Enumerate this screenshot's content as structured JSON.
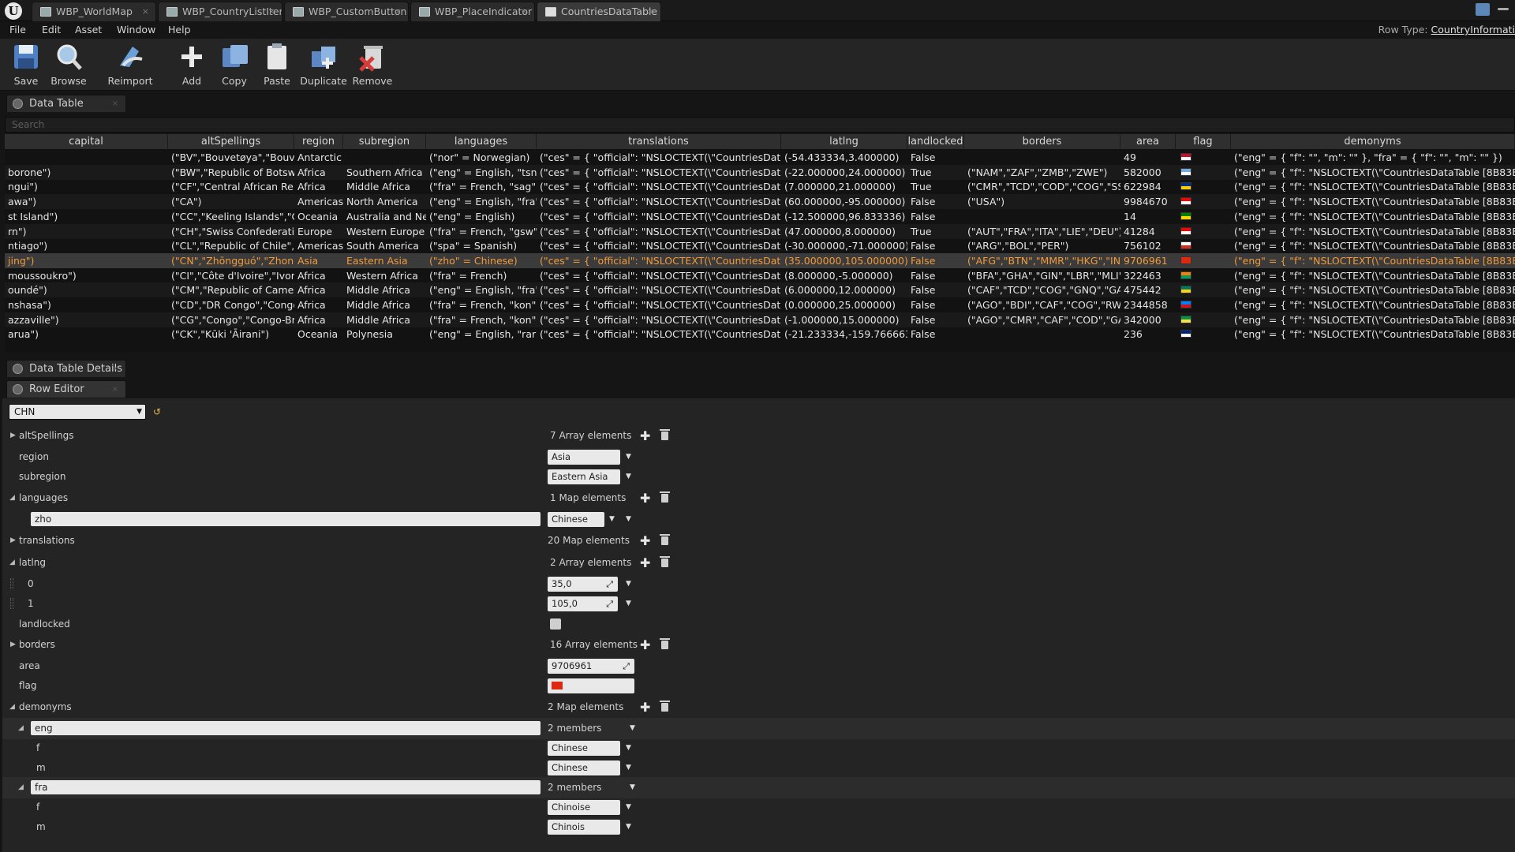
{
  "window": {
    "logo": "U",
    "tabs": [
      {
        "label": "WBP_WorldMap"
      },
      {
        "label": "WBP_CountryListItem"
      },
      {
        "label": "WBP_CustomButton"
      },
      {
        "label": "WBP_PlaceIndicator"
      },
      {
        "label": "CountriesDataTable"
      }
    ],
    "close_glyph": "×"
  },
  "menu": {
    "items": [
      "File",
      "Edit",
      "Asset",
      "Window",
      "Help"
    ],
    "row_type_label": "Row Type:",
    "row_type_value": "CountryInformati"
  },
  "toolbar": {
    "buttons": [
      {
        "label": "Save",
        "icon": "save-disk-icon"
      },
      {
        "label": "Browse",
        "icon": "magnifier-icon"
      },
      {
        "label": "Reimport",
        "icon": "reimport-arrow-icon"
      },
      {
        "label": "Add",
        "icon": "plus-icon"
      },
      {
        "label": "Copy",
        "icon": "copy-icon"
      },
      {
        "label": "Paste",
        "icon": "clipboard-icon"
      },
      {
        "label": "Duplicate",
        "icon": "duplicate-icon"
      },
      {
        "label": "Remove",
        "icon": "trash-remove-icon"
      }
    ]
  },
  "data_table": {
    "tab_label": "Data Table",
    "search_placeholder": "Search",
    "columns": [
      "capital",
      "altSpellings",
      "region",
      "subregion",
      "languages",
      "translations",
      "latlng",
      "landlocked",
      "borders",
      "area",
      "flag",
      "demonyms"
    ],
    "rows": [
      {
        "cells": [
          "",
          "(\"BV\",\"Bouvetøya\",\"Bouvet-",
          "Antarctic",
          "",
          "(\"nor\" = Norwegian)",
          "(\"ces\" = { \"official\": \"NSLOCTEXT(\\\"CountriesDataTable",
          "(-54.433334,3.400000)",
          "False",
          "",
          "49",
          "",
          "(\"eng\" = { \"f\": \"\", \"m\": \"\" }, \"fra\" = { \"f\": \"\", \"m\": \"\" })"
        ],
        "flag_colors": [
          "#c8102e",
          "#ffffff"
        ],
        "selected": false
      },
      {
        "cells": [
          "borone\")",
          "(\"BW\",\"Republic of Botswa",
          "Africa",
          "Southern Africa",
          "(\"eng\" = English, \"tsn\" =",
          "(\"ces\" = { \"official\": \"NSLOCTEXT(\\\"CountriesDataTable",
          "(-22.000000,24.000000)",
          "True",
          "(\"NAM\",\"ZAF\",\"ZMB\",\"ZWE\")",
          "582000",
          "",
          "(\"eng\" = { \"f\": \"NSLOCTEXT(\\\"CountriesDataTable [8B83B96C409"
        ],
        "flag_colors": [
          "#75aadb",
          "#ffffff"
        ],
        "selected": false
      },
      {
        "cells": [
          "ngui\")",
          "(\"CF\",\"Central African Repu",
          "Africa",
          "Middle Africa",
          "(\"fra\" = French, \"sag\" = S",
          "(\"ces\" = { \"official\": \"NSLOCTEXT(\\\"CountriesDataTable",
          "(7.000000,21.000000)",
          "True",
          "(\"CMR\",\"TCD\",\"COD\",\"COG\",\"SSD\",\"SI",
          "622984",
          "",
          "(\"eng\" = { \"f\": \"NSLOCTEXT(\\\"CountriesDataTable [8B83B96C409"
        ],
        "flag_colors": [
          "#003082",
          "#ffce00"
        ],
        "selected": false
      },
      {
        "cells": [
          "awa\")",
          "(\"CA\")",
          "Americas",
          "North America",
          "(\"eng\" = English, \"fra\" =",
          "(\"ces\" = { \"official\": \"NSLOCTEXT(\\\"CountriesDataTable",
          "(60.000000,-95.000000)",
          "False",
          "(\"USA\")",
          "9984670",
          "",
          "(\"eng\" = { \"f\": \"NSLOCTEXT(\\\"CountriesDataTable [8B83B96C409"
        ],
        "flag_colors": [
          "#ff0000",
          "#ffffff"
        ],
        "selected": false
      },
      {
        "cells": [
          "st Island\")",
          "(\"CC\",\"Keeling Islands\",\"Co",
          "Oceania",
          "Australia and Nev",
          "(\"eng\" = English)",
          "(\"ces\" = { \"official\": \"NSLOCTEXT(\\\"CountriesDataTable",
          "(-12.500000,96.833336)",
          "False",
          "",
          "14",
          "",
          "(\"eng\" = { \"f\": \"NSLOCTEXT(\\\"CountriesDataTable [8B83B96C409"
        ],
        "flag_colors": [
          "#008000",
          "#ffd700"
        ],
        "selected": false
      },
      {
        "cells": [
          "rn\")",
          "(\"CH\",\"Swiss Confederatior",
          "Europe",
          "Western Europe",
          "(\"fra\" = French, \"gsw\" = S",
          "(\"ces\" = { \"official\": \"NSLOCTEXT(\\\"CountriesDataTable",
          "(47.000000,8.000000)",
          "True",
          "(\"AUT\",\"FRA\",\"ITA\",\"LIE\",\"DEU\")",
          "41284",
          "",
          "(\"eng\" = { \"f\": \"NSLOCTEXT(\\\"CountriesDataTable [8B83B96C409"
        ],
        "flag_colors": [
          "#ff0000",
          "#ffffff"
        ],
        "selected": false
      },
      {
        "cells": [
          "ntiago\")",
          "(\"CL\",\"Republic of Chile\",\"R",
          "Americas",
          "South America",
          "(\"spa\" = Spanish)",
          "(\"ces\" = { \"official\": \"NSLOCTEXT(\\\"CountriesDataTable",
          "(-30.000000,-71.000000)",
          "False",
          "(\"ARG\",\"BOL\",\"PER\")",
          "756102",
          "",
          "(\"eng\" = { \"f\": \"NSLOCTEXT(\\\"CountriesDataTable [8B83B96C409"
        ],
        "flag_colors": [
          "#ffffff",
          "#d52b1e"
        ],
        "selected": false
      },
      {
        "cells": [
          "jing\")",
          "(\"CN\",\"Zhōngguó\",\"Zhongg",
          "Asia",
          "Eastern Asia",
          "(\"zho\" = Chinese)",
          "(\"ces\" = { \"official\": \"NSLOCTEXT(\\\"CountriesDataTable",
          "(35.000000,105.000000)",
          "False",
          "(\"AFG\",\"BTN\",\"MMR\",\"HKG\",\"IND\",\"K/",
          "9706961",
          "",
          "(\"eng\" = { \"f\": \"NSLOCTEXT(\\\"CountriesDataTable [8B83B96C409"
        ],
        "flag_colors": [
          "#de2910",
          "#de2910"
        ],
        "selected": true
      },
      {
        "cells": [
          "moussoukro\")",
          "(\"CI\",\"Côte d'Ivoire\",\"Ivory C",
          "Africa",
          "Western Africa",
          "(\"fra\" = French)",
          "(\"ces\" = { \"official\": \"NSLOCTEXT(\\\"CountriesDataTable",
          "(8.000000,-5.000000)",
          "False",
          "(\"BFA\",\"GHA\",\"GIN\",\"LBR\",\"MLI\")",
          "322463",
          "",
          "(\"eng\" = { \"f\": \"NSLOCTEXT(\\\"CountriesDataTable [8B83B96C409"
        ],
        "flag_colors": [
          "#f77f00",
          "#009e60"
        ],
        "selected": false
      },
      {
        "cells": [
          "oundé\")",
          "(\"CM\",\"Republic of Camero",
          "Africa",
          "Middle Africa",
          "(\"eng\" = English, \"fra\" =",
          "(\"ces\" = { \"official\": \"NSLOCTEXT(\\\"CountriesDataTable",
          "(6.000000,12.000000)",
          "False",
          "(\"CAF\",\"TCD\",\"COG\",\"GNQ\",\"GAB\",\"N(",
          "475442",
          "",
          "(\"eng\" = { \"f\": \"NSLOCTEXT(\\\"CountriesDataTable [8B83B96C409"
        ],
        "flag_colors": [
          "#007a5e",
          "#fcd116"
        ],
        "selected": false
      },
      {
        "cells": [
          "nshasa\")",
          "(\"CD\",\"DR Congo\",\"Congo-I",
          "Africa",
          "Middle Africa",
          "(\"fra\" = French, \"kon\" = k",
          "(\"ces\" = { \"official\": \"NSLOCTEXT(\\\"CountriesDataTable",
          "(0.000000,25.000000)",
          "False",
          "(\"AGO\",\"BDI\",\"CAF\",\"COG\",\"RWA\",\"SS",
          "2344858",
          "",
          "(\"eng\" = { \"f\": \"NSLOCTEXT(\\\"CountriesDataTable [8B83B96C409"
        ],
        "flag_colors": [
          "#007fff",
          "#ce1021"
        ],
        "selected": false
      },
      {
        "cells": [
          "azzaville\")",
          "(\"CG\",\"Congo\",\"Congo-Braz",
          "Africa",
          "Middle Africa",
          "(\"fra\" = French, \"kon\" = k",
          "(\"ces\" = { \"official\": \"NSLOCTEXT(\\\"CountriesDataTable",
          "(-1.000000,15.000000)",
          "False",
          "(\"AGO\",\"CMR\",\"CAF\",\"COD\",\"GAB\")",
          "342000",
          "",
          "(\"eng\" = { \"f\": \"NSLOCTEXT(\\\"CountriesDataTable [8B83B96C409"
        ],
        "flag_colors": [
          "#009543",
          "#fbde4a"
        ],
        "selected": false
      },
      {
        "cells": [
          "arua\")",
          "(\"CK\",\"Kūki 'Āirani\")",
          "Oceania",
          "Polynesia",
          "(\"eng\" = English, \"rar\" =",
          "(\"ces\" = { \"official\": \"NSLOCTEXT(\\\"CountriesDataTable",
          "(-21.233334,-159.766663)",
          "False",
          "",
          "236",
          "",
          "(\"eng\" = { \"f\": \"NSLOCTEXT(\\\"CountriesDataTable [8B83B96C409"
        ],
        "flag_colors": [
          "#00247d",
          "#ffffff"
        ],
        "selected": false
      }
    ]
  },
  "details": {
    "tab_label": "Data Table Details"
  },
  "row_editor": {
    "tab_label": "Row Editor",
    "selected_row": "CHN",
    "reset_glyph": "↺",
    "expand_glyph": "▶",
    "collapse_glyph": "◢",
    "dropdown_glyph": "▼",
    "plus_glyph": "✚",
    "spin_glyph": "⤢",
    "properties": {
      "altSpellings": {
        "label": "altSpellings",
        "summary": "7 Array elements"
      },
      "region": {
        "label": "region",
        "value": "Asia"
      },
      "subregion": {
        "label": "subregion",
        "value": "Eastern Asia"
      },
      "languages": {
        "label": "languages",
        "summary": "1 Map elements",
        "key": "zho",
        "value": "Chinese"
      },
      "translations": {
        "label": "translations",
        "summary": "20 Map elements"
      },
      "latlng": {
        "label": "latlng",
        "summary": "2 Array elements",
        "items": [
          {
            "index": "0",
            "value": "35,0"
          },
          {
            "index": "1",
            "value": "105,0"
          }
        ]
      },
      "landlocked": {
        "label": "landlocked",
        "checked": false
      },
      "borders": {
        "label": "borders",
        "summary": "16 Array elements"
      },
      "area": {
        "label": "area",
        "value": "9706961"
      },
      "flag": {
        "label": "flag",
        "emoji_colors": "#de2910"
      },
      "demonyms": {
        "label": "demonyms",
        "summary": "2 Map elements",
        "eng": {
          "key": "eng",
          "summary": "2 members",
          "f_label": "f",
          "f": "Chinese",
          "m_label": "m",
          "m": "Chinese"
        },
        "fra": {
          "key": "fra",
          "summary": "2 members",
          "f_label": "f",
          "f": "Chinoise",
          "m_label": "m",
          "m": "Chinois"
        }
      }
    }
  },
  "colors": {
    "selected_text": "#f29a3b",
    "accent_reset": "#e6b84e"
  }
}
